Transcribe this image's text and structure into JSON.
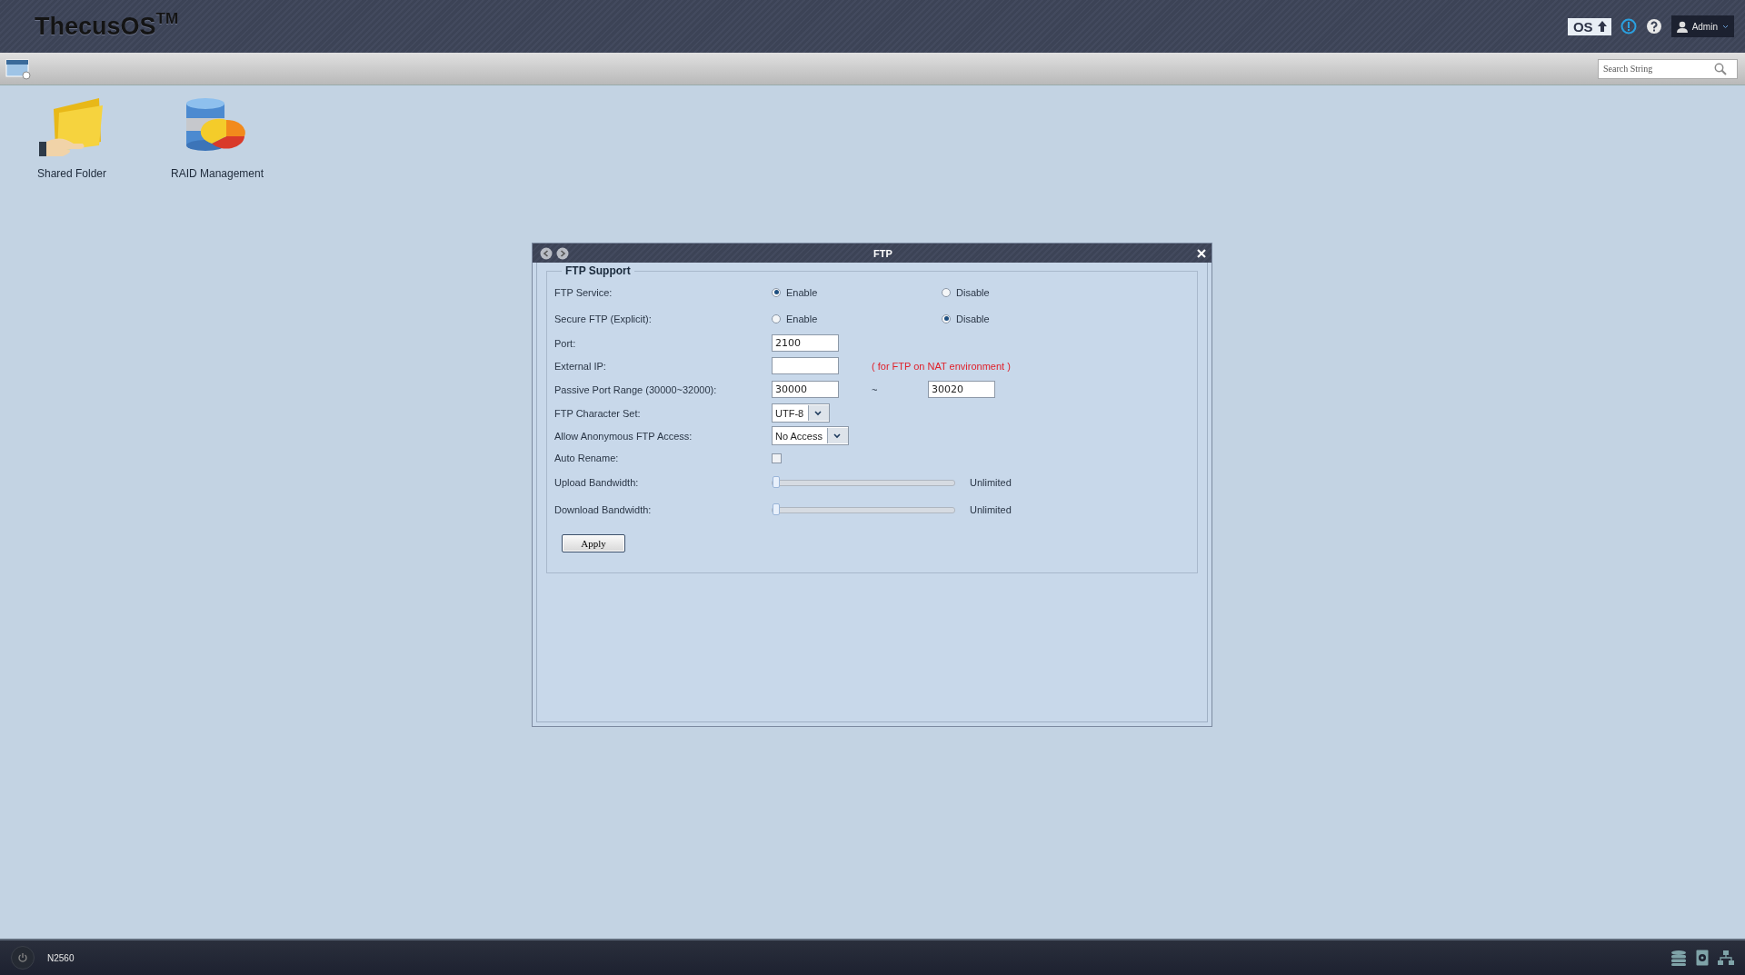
{
  "header": {
    "logo": "ThecusOS",
    "logo_mark": "TM",
    "os_badge": "OS",
    "user": "Admin"
  },
  "toolbar": {
    "search": {
      "placeholder": "Search String"
    }
  },
  "desktop_icons": [
    {
      "label": "Shared Folder",
      "kind": "folder"
    },
    {
      "label": "RAID Management",
      "kind": "raid"
    }
  ],
  "window": {
    "title": "FTP",
    "section": "FTP Support",
    "apply": "Apply",
    "rows": [
      {
        "kind": "radio",
        "label": "FTP Service:",
        "options": [
          {
            "label": "Enable",
            "selected": true
          },
          {
            "label": "Disable",
            "selected": false
          }
        ]
      },
      {
        "kind": "radio",
        "label": "Secure FTP (Explicit):",
        "options": [
          {
            "label": "Enable",
            "selected": false
          },
          {
            "label": "Disable",
            "selected": true
          }
        ]
      },
      {
        "kind": "text",
        "label": "Port:",
        "value": "2100"
      },
      {
        "kind": "text",
        "label": "External IP:",
        "note": "( for FTP on NAT environment )"
      },
      {
        "kind": "range",
        "label": "Passive Port Range (30000~32000):",
        "from": "30000",
        "separator": "~",
        "to": "30020"
      },
      {
        "kind": "select",
        "label": "FTP Character Set:",
        "value": "UTF-8"
      },
      {
        "kind": "select",
        "label": "Allow Anonymous FTP Access:",
        "value": "No Access"
      },
      {
        "kind": "checkbox",
        "label": "Auto Rename:",
        "checked": false
      },
      {
        "kind": "slider",
        "label": "Upload Bandwidth:",
        "level": 0,
        "reading": "Unlimited"
      },
      {
        "kind": "slider",
        "label": "Download Bandwidth:",
        "level": 0,
        "reading": "Unlimited"
      }
    ]
  },
  "taskbar": {
    "device": "N2560"
  }
}
